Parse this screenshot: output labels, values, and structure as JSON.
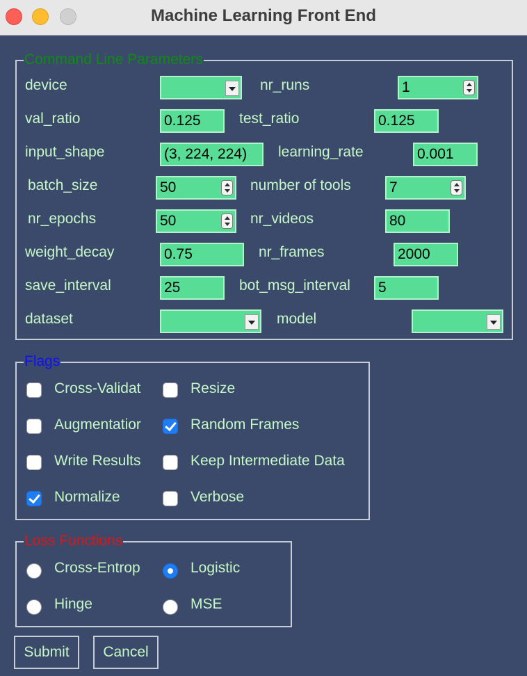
{
  "window": {
    "title": "Machine Learning Front End"
  },
  "colors": {
    "background": "#3b4a6b",
    "label_text": "#c6f7c6",
    "field_bg": "#57dd95",
    "cmd_title": "#0f8a14",
    "flags_title": "#1010f0",
    "loss_title": "#e01414",
    "check_accent": "#1e7cf5"
  },
  "cmd": {
    "title": "Command Line Parameters",
    "device": {
      "label": "device",
      "value": ""
    },
    "nr_runs": {
      "label": "nr_runs",
      "value": "1"
    },
    "val_ratio": {
      "label": "val_ratio",
      "value": "0.125"
    },
    "test_ratio": {
      "label": "test_ratio",
      "value": "0.125"
    },
    "input_shape": {
      "label": "input_shape",
      "value": "(3, 224, 224)"
    },
    "learning_rate": {
      "label": "learning_rate",
      "value": "0.001"
    },
    "batch_size": {
      "label": "batch_size",
      "value": "50"
    },
    "number_of_tools": {
      "label": "number of tools",
      "value": "7"
    },
    "nr_epochs": {
      "label": "nr_epochs",
      "value": "50"
    },
    "nr_videos": {
      "label": "nr_videos",
      "value": "80"
    },
    "weight_decay": {
      "label": "weight_decay",
      "value": "0.75"
    },
    "nr_frames": {
      "label": "nr_frames",
      "value": "2000"
    },
    "save_interval": {
      "label": "save_interval",
      "value": "25"
    },
    "bot_msg_interval": {
      "label": "bot_msg_interval",
      "value": "5"
    },
    "dataset": {
      "label": "dataset",
      "value": ""
    },
    "model": {
      "label": "model",
      "value": ""
    }
  },
  "flags": {
    "title": "Flags",
    "cross_validation": {
      "label": "Cross-Validat",
      "checked": false
    },
    "resize": {
      "label": "Resize",
      "checked": false
    },
    "augmentation": {
      "label": "Augmentatior",
      "checked": false
    },
    "random_frames": {
      "label": "Random Frames",
      "checked": true
    },
    "write_results": {
      "label": "Write Results",
      "checked": false
    },
    "keep_intermediate": {
      "label": "Keep Intermediate Data",
      "checked": false
    },
    "normalize": {
      "label": "Normalize",
      "checked": true
    },
    "verbose": {
      "label": "Verbose",
      "checked": false
    }
  },
  "loss": {
    "title": "Loss Functions",
    "cross_entropy": {
      "label": "Cross-Entrop",
      "selected": false
    },
    "logistic": {
      "label": "Logistic",
      "selected": true
    },
    "hinge": {
      "label": "Hinge",
      "selected": false
    },
    "mse": {
      "label": "MSE",
      "selected": false
    }
  },
  "buttons": {
    "submit": "Submit",
    "cancel": "Cancel"
  }
}
